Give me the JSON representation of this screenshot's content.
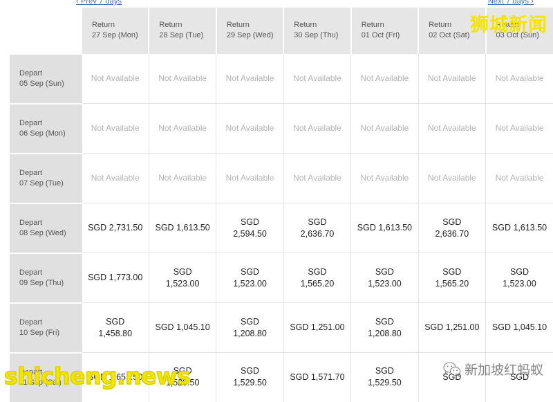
{
  "nav": {
    "prev_label": "‹ Prev 7 days",
    "next_label": "Next 7 days ›"
  },
  "table": {
    "return_prefix": "Return",
    "depart_prefix": "Depart",
    "not_available": "Not Available",
    "currency": "SGD",
    "columns": [
      {
        "label": "Return",
        "date": "27 Sep (Mon)"
      },
      {
        "label": "Return",
        "date": "28 Sep (Tue)"
      },
      {
        "label": "Return",
        "date": "29 Sep (Wed)"
      },
      {
        "label": "Return",
        "date": "30 Sep (Thu)"
      },
      {
        "label": "Return",
        "date": "01 Oct (Fri)"
      },
      {
        "label": "Return",
        "date": "02 Oct (Sat)"
      },
      {
        "label": "Return",
        "date": "03 Oct (Sun)"
      }
    ],
    "rows": [
      {
        "label": "Depart",
        "date": "05 Sep (Sun)",
        "cells": [
          {
            "available": false,
            "text": "Not Available"
          },
          {
            "available": false,
            "text": "Not Available"
          },
          {
            "available": false,
            "text": "Not Available"
          },
          {
            "available": false,
            "text": "Not Available"
          },
          {
            "available": false,
            "text": "Not Available"
          },
          {
            "available": false,
            "text": "Not Available"
          },
          {
            "available": false,
            "text": "Not Available"
          }
        ]
      },
      {
        "label": "Depart",
        "date": "06 Sep (Mon)",
        "cells": [
          {
            "available": false,
            "text": "Not Available"
          },
          {
            "available": false,
            "text": "Not Available"
          },
          {
            "available": false,
            "text": "Not Available"
          },
          {
            "available": false,
            "text": "Not Available"
          },
          {
            "available": false,
            "text": "Not Available"
          },
          {
            "available": false,
            "text": "Not Available"
          },
          {
            "available": false,
            "text": "Not Available"
          }
        ]
      },
      {
        "label": "Depart",
        "date": "07 Sep (Tue)",
        "cells": [
          {
            "available": false,
            "text": "Not Available"
          },
          {
            "available": false,
            "text": "Not Available"
          },
          {
            "available": false,
            "text": "Not Available"
          },
          {
            "available": false,
            "text": "Not Available"
          },
          {
            "available": false,
            "text": "Not Available"
          },
          {
            "available": false,
            "text": "Not Available"
          },
          {
            "available": false,
            "text": "Not Available"
          }
        ]
      },
      {
        "label": "Depart",
        "date": "08 Sep (Wed)",
        "cells": [
          {
            "available": true,
            "currency": "SGD",
            "amount": "2,731.50",
            "wrap": false
          },
          {
            "available": true,
            "currency": "SGD",
            "amount": "1,613.50",
            "wrap": false
          },
          {
            "available": true,
            "currency": "SGD",
            "amount": "2,594.50",
            "wrap": true
          },
          {
            "available": true,
            "currency": "SGD",
            "amount": "2,636.70",
            "wrap": true
          },
          {
            "available": true,
            "currency": "SGD",
            "amount": "1,613.50",
            "wrap": false
          },
          {
            "available": true,
            "currency": "SGD",
            "amount": "2,636.70",
            "wrap": true
          },
          {
            "available": true,
            "currency": "SGD",
            "amount": "1,613.50",
            "wrap": false
          }
        ]
      },
      {
        "label": "Depart",
        "date": "09 Sep (Thu)",
        "cells": [
          {
            "available": true,
            "currency": "SGD",
            "amount": "1,773.00",
            "wrap": false
          },
          {
            "available": true,
            "currency": "SGD",
            "amount": "1,523.00",
            "wrap": true
          },
          {
            "available": true,
            "currency": "SGD",
            "amount": "1,523.00",
            "wrap": true
          },
          {
            "available": true,
            "currency": "SGD",
            "amount": "1,565.20",
            "wrap": true
          },
          {
            "available": true,
            "currency": "SGD",
            "amount": "1,523.00",
            "wrap": true
          },
          {
            "available": true,
            "currency": "SGD",
            "amount": "1,565.20",
            "wrap": true
          },
          {
            "available": true,
            "currency": "SGD",
            "amount": "1,523.00",
            "wrap": true
          }
        ]
      },
      {
        "label": "Depart",
        "date": "10 Sep (Fri)",
        "cells": [
          {
            "available": true,
            "currency": "SGD",
            "amount": "1,458.80",
            "wrap": true
          },
          {
            "available": true,
            "currency": "SGD",
            "amount": "1,045.10",
            "wrap": false
          },
          {
            "available": true,
            "currency": "SGD",
            "amount": "1,208.80",
            "wrap": true
          },
          {
            "available": true,
            "currency": "SGD",
            "amount": "1,251.00",
            "wrap": false
          },
          {
            "available": true,
            "currency": "SGD",
            "amount": "1,208.80",
            "wrap": true
          },
          {
            "available": true,
            "currency": "SGD",
            "amount": "1,251.00",
            "wrap": false
          },
          {
            "available": true,
            "currency": "SGD",
            "amount": "1,045.10",
            "wrap": false
          }
        ]
      },
      {
        "label": "Depart",
        "date": "11 Sep (Sat)",
        "cells": [
          {
            "available": true,
            "currency": "SGD",
            "amount": "1,651.50",
            "wrap": false
          },
          {
            "available": true,
            "currency": "SGD",
            "amount": "1,529.50",
            "wrap": true
          },
          {
            "available": true,
            "currency": "SGD",
            "amount": "1,529.50",
            "wrap": true
          },
          {
            "available": true,
            "currency": "SGD",
            "amount": "1,571.70",
            "wrap": false
          },
          {
            "available": true,
            "currency": "SGD",
            "amount": "1,529.50",
            "wrap": true
          },
          {
            "available": true,
            "currency": "SGD",
            "amount": "",
            "wrap": false
          },
          {
            "available": true,
            "currency": "SGD",
            "amount": "",
            "wrap": true
          }
        ]
      }
    ]
  },
  "watermarks": {
    "top_right": "狮城新闻",
    "bottom_left": "shicheng.news",
    "wechat_text": "新加坡红蚂蚁"
  },
  "colors": {
    "header_bg": "#e6e6e6",
    "rowhead_bg": "#e0e0e0",
    "link": "#4a6fb5",
    "watermark_yellow": "#f5e400",
    "na_text": "#b3b3b3"
  }
}
